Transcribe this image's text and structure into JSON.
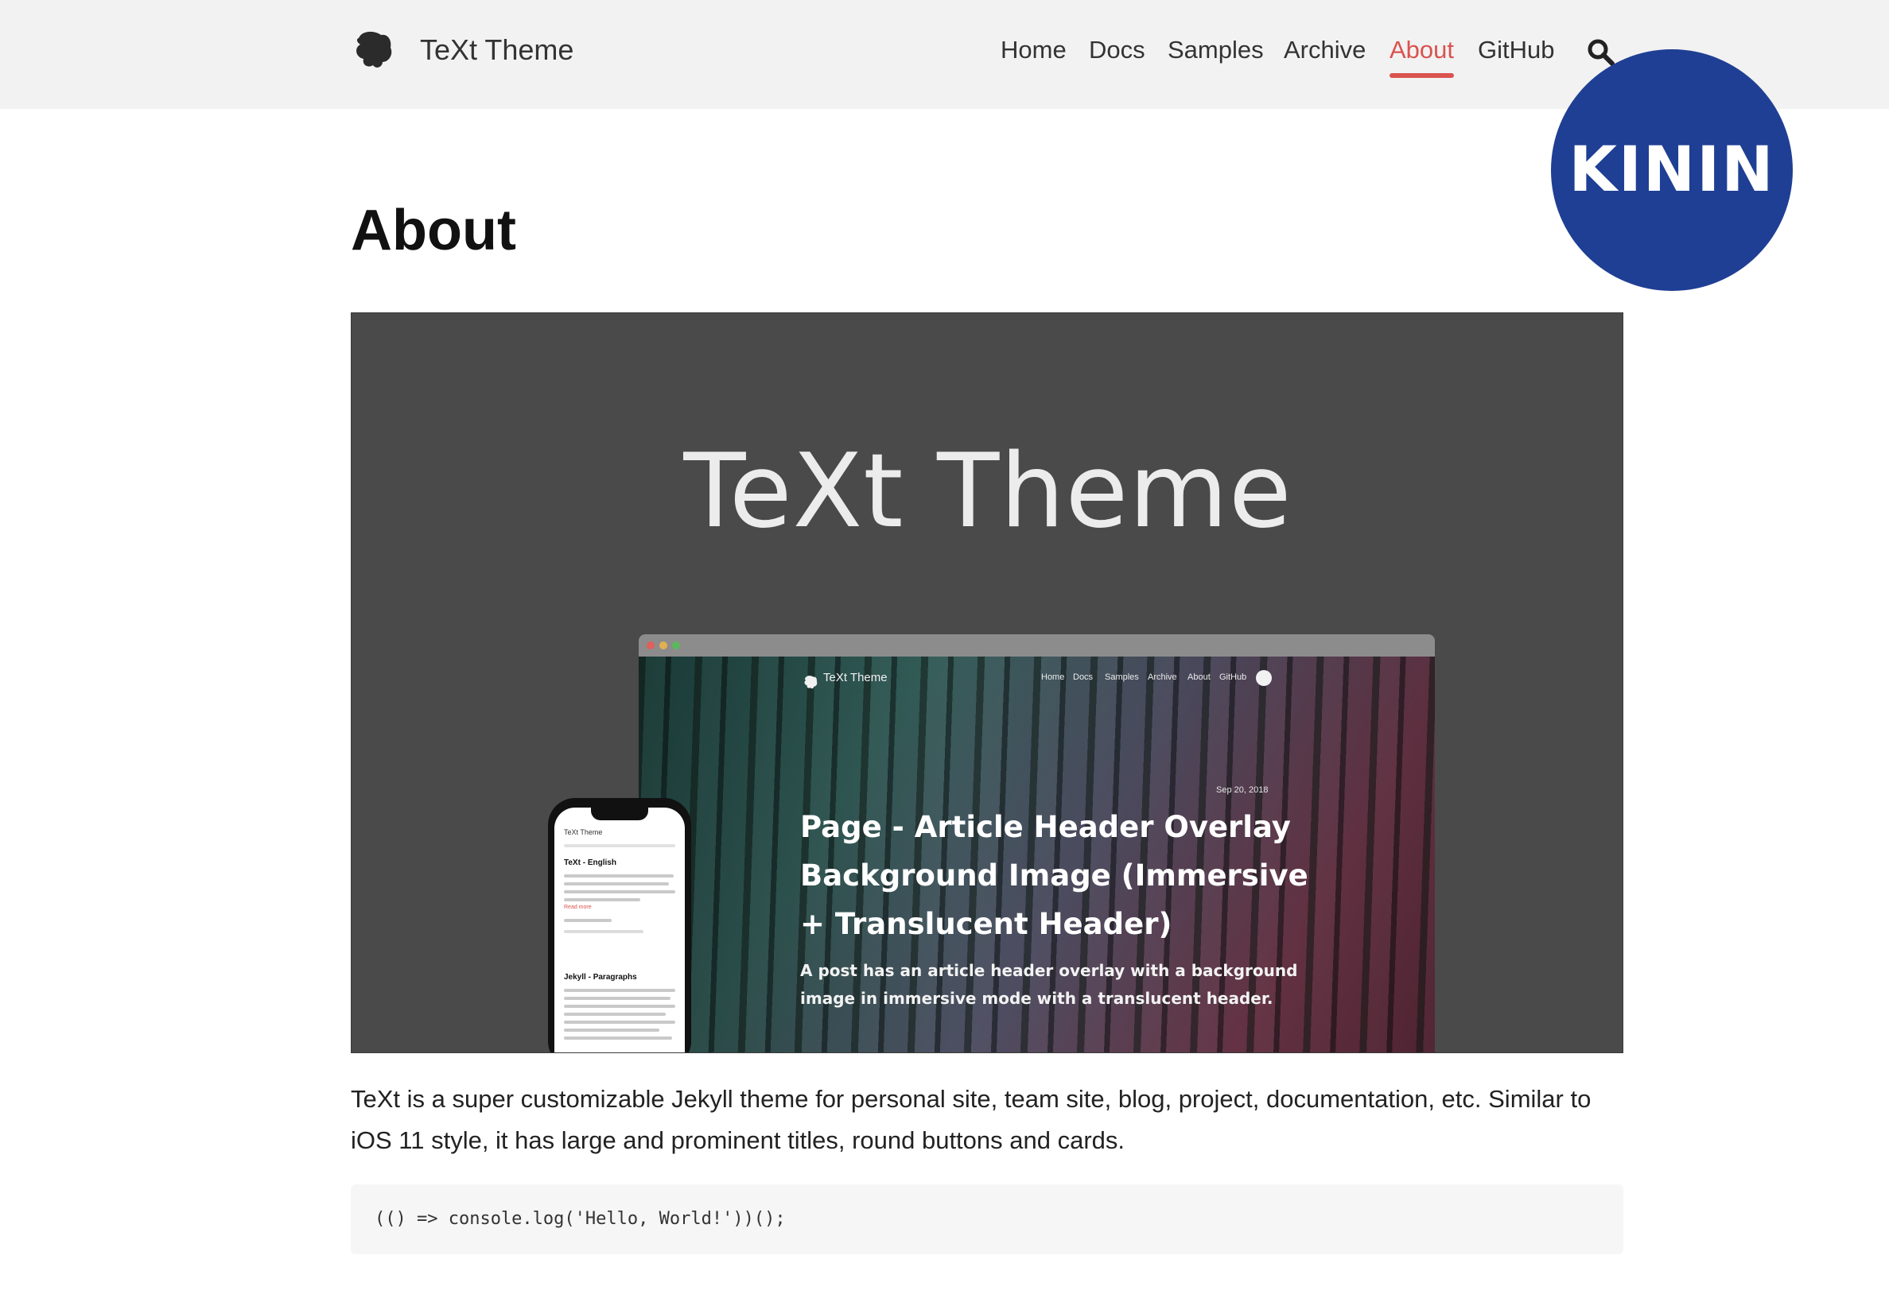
{
  "header": {
    "site_title": "TeXt Theme",
    "nav": [
      "Home",
      "Docs",
      "Samples",
      "Archive",
      "About",
      "GitHub"
    ],
    "active_nav": "About"
  },
  "badge": {
    "text": "KININ",
    "color": "#1f3f94"
  },
  "page": {
    "title": "About",
    "intro": "TeXt is a super customizable Jekyll theme for personal site, team site, blog, project, documentation, etc. Similar to iOS 11 style, it has large and prominent titles, round buttons and cards.",
    "code": "(() => console.log('Hello, World!'))();"
  },
  "hero": {
    "title": "TeXt Theme",
    "laptop": {
      "site_title": "TeXt Theme",
      "nav": [
        "Home",
        "Docs",
        "Samples",
        "Archive",
        "About",
        "GitHub"
      ],
      "date": "Sep 20, 2018",
      "heading": "Page - Article Header Overlay Background Image (Immersive + Translucent Header)",
      "subtitle": "A post has an article header overlay with a background image in immersive mode with a translucent header."
    },
    "phone": {
      "site_title": "TeXt Theme",
      "post1_title": "TeXt - English",
      "read_more": "Read more",
      "post2_title": "Jekyll - Paragraphs"
    }
  },
  "colors": {
    "accent": "#d9534f",
    "header_bg": "#f2f2f2",
    "hero_bg": "#4a4a4a"
  }
}
